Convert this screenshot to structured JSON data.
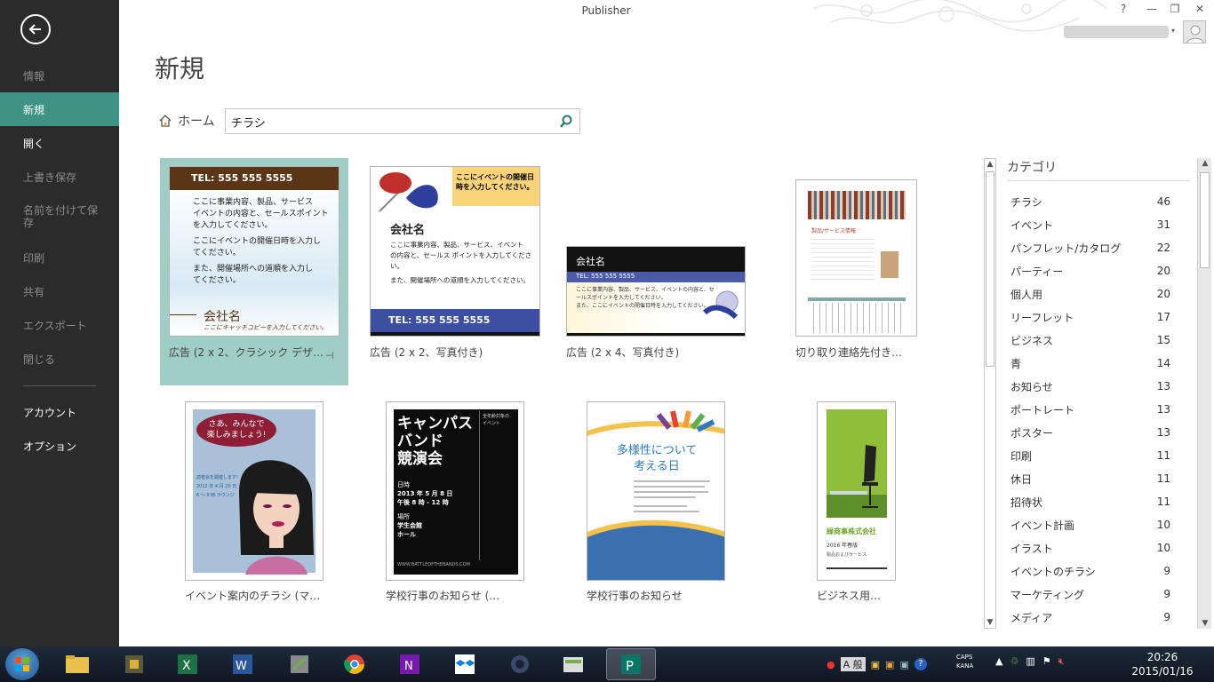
{
  "app": {
    "title": "Publisher"
  },
  "window": {
    "help": "?",
    "minimize": "—",
    "restore": "❐",
    "close": "✕",
    "user_name": " ",
    "user_dropdown": "▾"
  },
  "sidebar": {
    "items": [
      {
        "label": "情報",
        "state": "disabled"
      },
      {
        "label": "新規",
        "state": "active"
      },
      {
        "label": "開く",
        "state": "enabled"
      },
      {
        "label": "上書き保存",
        "state": "disabled"
      },
      {
        "label": "名前を付けて保存",
        "state": "disabled"
      },
      {
        "label": "印刷",
        "state": "disabled"
      },
      {
        "label": "共有",
        "state": "disabled"
      },
      {
        "label": "エクスポート",
        "state": "disabled"
      },
      {
        "label": "閉じる",
        "state": "disabled"
      },
      {
        "label": "アカウント",
        "state": "enabled"
      },
      {
        "label": "オプション",
        "state": "enabled"
      }
    ]
  },
  "main": {
    "title": "新規",
    "home_label": "ホーム",
    "search": {
      "value": "チラシ",
      "placeholder": ""
    }
  },
  "templates": [
    {
      "label": "広告 (2 x 2、クラシック デザ…",
      "selected": true,
      "thumb": {
        "tel": "TEL: 555 555 5555",
        "p1": "ここに事業内容、製品、サービス",
        "p2": "イベントの内容と、セールスポイント",
        "p3": "を入力してください。",
        "p4": "ここにイベントの開催日時を入力し",
        "p5": "てください。",
        "p6": "また、開催場所への道順を入力し",
        "p7": "てください。",
        "company": "会社名",
        "catch": "ここにキャッチコピーを入力してください。"
      }
    },
    {
      "label": "広告 (2 x 2、写真付き)",
      "selected": false,
      "thumb": {
        "top": "ここにイベントの開催日",
        "top2": "時を入力してください。",
        "company": "会社名",
        "p1": "ここに事業内容、製品、サービス、イベント",
        "p2": "の内容と、セールス ポイントを入力してくださ",
        "p3": "い。",
        "p4": "また、開催場所への道順を入力してください。",
        "tel": "TEL: 555 555 5555"
      }
    },
    {
      "label": "広告 (2 x 4、写真付き)",
      "selected": false,
      "thumb": {
        "company": "会社名",
        "tel": "TEL: 555 555 5555",
        "p1": "ここに事業内容、製品、サービス、イベントの内容と、セ",
        "p2": "ールスポイントを入力してください。",
        "p3": "また、ここにイベントの開催日時を入力してください。"
      }
    },
    {
      "label": "切り取り連絡先付き…",
      "selected": false,
      "thumb": {
        "head": "製品/サービス情報"
      }
    },
    {
      "label": "イベント案内のチラシ (マ…",
      "selected": false,
      "thumb": {
        "bubble1": "さあ、みんなで",
        "bubble2": "楽しみましょう!",
        "t1": "読者会を開催します!",
        "t2": "2012 年 4 月 20 日",
        "t3": "6 ～ 9 時 ラウンジ"
      }
    },
    {
      "label": "学校行事のお知らせ (…",
      "selected": false,
      "thumb": {
        "t1": "キャンパス",
        "t2": "バンド",
        "t3": "競演会",
        "date_h": "日時",
        "date": "2013 年 5 月 8 日",
        "time": "午後 8 時 - 12 時",
        "place_h": "場所",
        "place": "学生会館",
        "place2": "ホール",
        "side1": "全年齢対象の",
        "side2": "イベント",
        "footer": "WWW.BATTLEOFTHEBANDS.COM"
      }
    },
    {
      "label": "学校行事のお知らせ",
      "selected": false,
      "thumb": {
        "t1": "多様性について",
        "t2": "考える日"
      }
    },
    {
      "label": "ビジネス用…",
      "selected": false,
      "thumb": {
        "company": "緑商事株式会社",
        "year": "2016 年春版",
        "sub": "製品およびサービス"
      }
    }
  ],
  "categories": {
    "heading": "カテゴリ",
    "items": [
      {
        "name": "チラシ",
        "count": 46
      },
      {
        "name": "イベント",
        "count": 31
      },
      {
        "name": "パンフレット/カタログ",
        "count": 22
      },
      {
        "name": "パーティー",
        "count": 20
      },
      {
        "name": "個人用",
        "count": 20
      },
      {
        "name": "リーフレット",
        "count": 17
      },
      {
        "name": "ビジネス",
        "count": 15
      },
      {
        "name": "青",
        "count": 14
      },
      {
        "name": "お知らせ",
        "count": 13
      },
      {
        "name": "ポートレート",
        "count": 13
      },
      {
        "name": "ポスター",
        "count": 13
      },
      {
        "name": "印刷",
        "count": 11
      },
      {
        "name": "休日",
        "count": 11
      },
      {
        "name": "招待状",
        "count": 11
      },
      {
        "name": "イベント計画",
        "count": 10
      },
      {
        "name": "イラスト",
        "count": 10
      },
      {
        "name": "イベントのチラシ",
        "count": 9
      },
      {
        "name": "マーケティング",
        "count": 9
      },
      {
        "name": "メディア",
        "count": 9
      }
    ]
  },
  "taskbar": {
    "ime": "A 般",
    "caps": "CAPS",
    "kana": "KANA",
    "time": "20:26",
    "date": "2015/01/16"
  },
  "colors": {
    "sidebar": "#2b2b2b",
    "accent": "#3e9384",
    "selected_tile": "#9ecec6"
  }
}
